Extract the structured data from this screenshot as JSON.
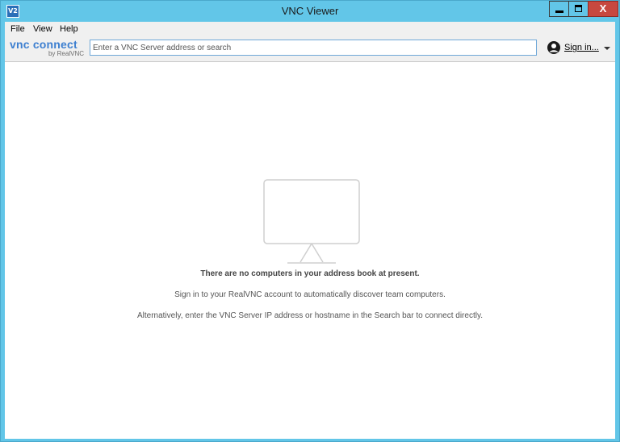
{
  "window": {
    "title": "VNC Viewer",
    "app_icon_text": "V2",
    "close_glyph": "X"
  },
  "menu": {
    "items": [
      "File",
      "View",
      "Help"
    ]
  },
  "toolbar": {
    "logo_main": "vnc connect",
    "logo_sub": "by RealVNC",
    "search_placeholder": "Enter a VNC Server address or search",
    "search_value": "",
    "signin_label": "Sign in..."
  },
  "empty_state": {
    "heading": "There are no computers in your address book at present.",
    "line1": "Sign in to your RealVNC account to automatically discover team computers.",
    "line2": "Alternatively, enter the VNC Server IP address or hostname in the Search bar to connect directly."
  },
  "colors": {
    "frame": "#62c6e8",
    "close_button": "#c7483f",
    "logo_blue": "#3d7fd0",
    "search_border": "#6fa8d8"
  }
}
